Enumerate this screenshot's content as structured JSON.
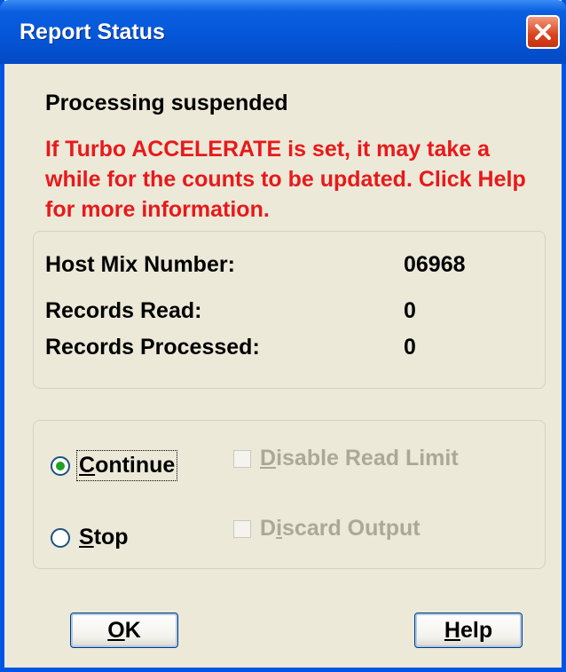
{
  "window": {
    "title": "Report Status"
  },
  "status": {
    "message": "Processing suspended",
    "warning": "If Turbo ACCELERATE is set, it may take a while for the counts to be updated. Click Help for more information."
  },
  "stats": [
    {
      "label": "Host Mix Number:",
      "value": "06968"
    },
    {
      "label": "Records Read:",
      "value": "0"
    },
    {
      "label": "Records Processed:",
      "value": "0"
    }
  ],
  "options": {
    "continue": {
      "label_mnemonic": "C",
      "label_rest": "ontinue",
      "selected": true
    },
    "stop": {
      "label_mnemonic": "S",
      "label_rest": "top",
      "selected": false
    },
    "disable_read_limit": {
      "label_mnemonic": "D",
      "label_rest": "isable Read Limit",
      "enabled": false
    },
    "discard_output": {
      "label_pre": "D",
      "label_mnemonic": "i",
      "label_rest": "scard Output",
      "enabled": false
    }
  },
  "buttons": {
    "ok": {
      "label_mnemonic": "O",
      "label_rest": "K"
    },
    "help": {
      "label_mnemonic": "H",
      "label_rest": "elp"
    }
  },
  "icons": {
    "close": "close-icon"
  },
  "colors": {
    "titlebar": "#0457D8",
    "warning_text": "#E8191B",
    "close_button": "#D9431C",
    "radio_dot": "#21A121"
  }
}
